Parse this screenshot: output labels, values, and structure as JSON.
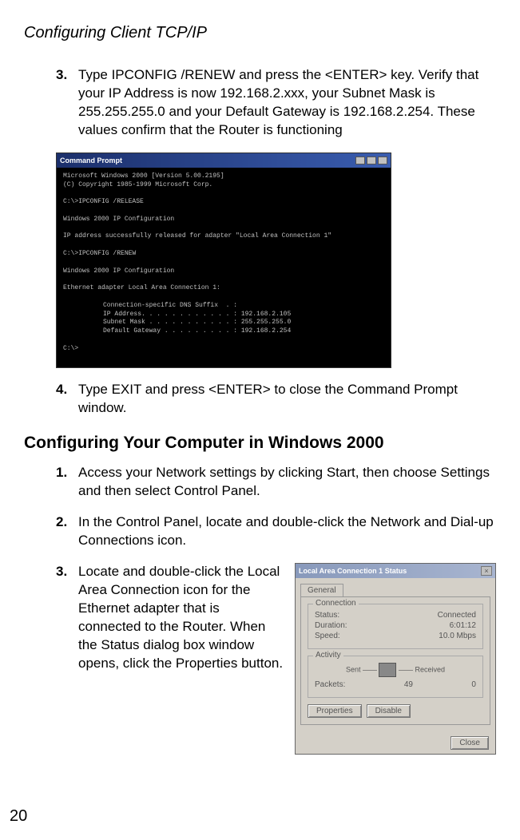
{
  "header": {
    "title": "Configuring Client TCP/IP"
  },
  "steps_a": {
    "3": {
      "num": "3.",
      "text": "Type IPCONFIG /RENEW and press the <ENTER> key. Verify that your IP Address is now 192.168.2.xxx, your Subnet Mask is 255.255.255.0 and your Default Gateway is 192.168.2.254. These values confirm that the Router is functioning"
    },
    "4": {
      "num": "4.",
      "text": "Type EXIT and press <ENTER> to close the Command Prompt window."
    }
  },
  "section_heading": "Configuring Your Computer in Windows 2000",
  "steps_b": {
    "1": {
      "num": "1.",
      "text": "Access your Network settings by clicking Start, then choose Settings and then select Control Panel."
    },
    "2": {
      "num": "2.",
      "text": "In the Control Panel, locate and double-click the Network and Dial-up Connections icon."
    },
    "3": {
      "num": "3.",
      "text": "Locate and double-click the Local Area Connection icon for the Ethernet adapter that is connected to the Router. When the Status dialog box window opens, click the Properties button."
    }
  },
  "cmd": {
    "title": "Command Prompt",
    "lines": {
      "l1": "Microsoft Windows 2000 [Version 5.00.2195]",
      "l2": "(C) Copyright 1985-1999 Microsoft Corp.",
      "l3": "C:\\>IPCONFIG /RELEASE",
      "l4": "Windows 2000 IP Configuration",
      "l5": "IP address successfully released for adapter \"Local Area Connection 1\"",
      "l6": "C:\\>IPCONFIG /RENEW",
      "l7": "Windows 2000 IP Configuration",
      "l8": "Ethernet adapter Local Area Connection 1:",
      "i1": "Connection-specific DNS Suffix  . :",
      "i2": "IP Address. . . . . . . . . . . . : 192.168.2.105",
      "i3": "Subnet Mask . . . . . . . . . . . : 255.255.255.0",
      "i4": "Default Gateway . . . . . . . . . : 192.168.2.254",
      "l9": "C:\\>"
    }
  },
  "dialog": {
    "title": "Local Area Connection 1 Status",
    "tab": "General",
    "grp_conn": "Connection",
    "status_l": "Status:",
    "status_v": "Connected",
    "duration_l": "Duration:",
    "duration_v": "6:01:12",
    "speed_l": "Speed:",
    "speed_v": "10.0 Mbps",
    "grp_act": "Activity",
    "sent": "Sent",
    "dashes": "——",
    "received": "Received",
    "packets_l": "Packets:",
    "packets_sent": "49",
    "packets_recv": "0",
    "btn_props": "Properties",
    "btn_disable": "Disable",
    "btn_close": "Close"
  },
  "page_number": "20"
}
